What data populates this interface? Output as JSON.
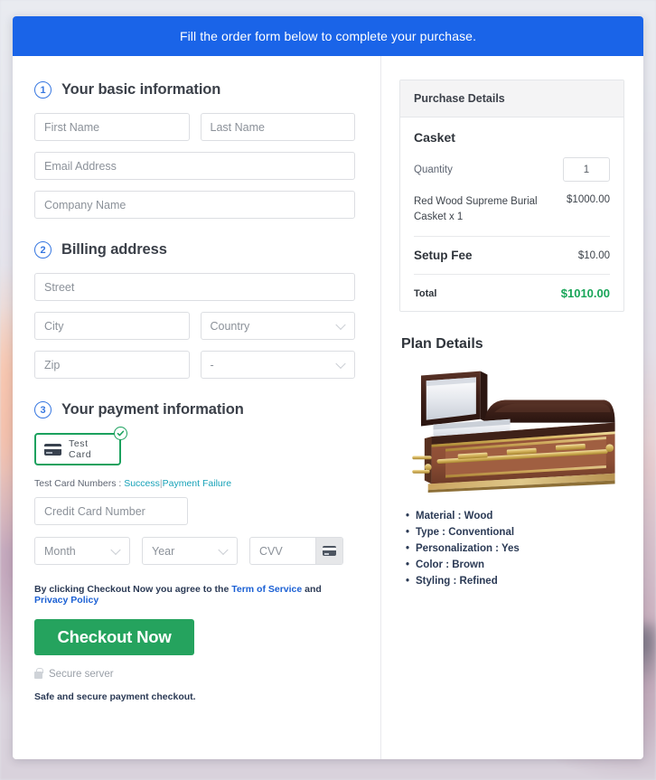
{
  "banner": {
    "text": "Fill the order form below to complete your purchase."
  },
  "steps": {
    "one": {
      "num": "1",
      "title": "Your basic information"
    },
    "two": {
      "num": "2",
      "title": "Billing address"
    },
    "three": {
      "num": "3",
      "title": "Your payment information"
    }
  },
  "basic": {
    "first_name_placeholder": "First Name",
    "last_name_placeholder": "Last Name",
    "email_placeholder": "Email Address",
    "company_placeholder": "Company Name"
  },
  "billing": {
    "street_placeholder": "Street",
    "city_placeholder": "City",
    "country_placeholder": "Country",
    "zip_placeholder": "Zip",
    "state_placeholder": "-"
  },
  "payment": {
    "test_card_label": "Test Card",
    "test_numbers_prefix": "Test Card Numbers :",
    "success_link": "Success",
    "pipe": "|",
    "failure_link": "Payment Failure",
    "cc_number_placeholder": "Credit Card Number",
    "month_placeholder": "Month",
    "year_placeholder": "Year",
    "cvv_placeholder": "CVV"
  },
  "agreement": {
    "prefix": "By clicking Checkout Now you agree to the",
    "terms_link": "Term of Service",
    "and": "and",
    "privacy_link": "Privacy Policy"
  },
  "actions": {
    "checkout_label": "Checkout Now",
    "secure_server": "Secure server",
    "safe_note": "Safe and secure payment checkout."
  },
  "purchase": {
    "panel_title": "Purchase Details",
    "product_title": "Casket",
    "quantity_label": "Quantity",
    "quantity_value": "1",
    "item_name": "Red Wood Supreme Burial Casket x 1",
    "item_price": "$1000.00",
    "setup_fee_label": "Setup Fee",
    "setup_fee_price": "$10.00",
    "total_label": "Total",
    "total_price": "$1010.00"
  },
  "plan": {
    "title": "Plan Details",
    "image_alt": "brown-wood-burial-casket",
    "specs": [
      "Material : Wood",
      "Type : Conventional",
      "Personalization : Yes",
      "Color : Brown",
      "Styling : Refined"
    ]
  },
  "colors": {
    "banner_blue": "#1a64e8",
    "accent_blue": "#3576e0",
    "green": "#25a35e",
    "total_green": "#18a558",
    "link_teal": "#17a2b8",
    "link_blue": "#1b60d4"
  }
}
